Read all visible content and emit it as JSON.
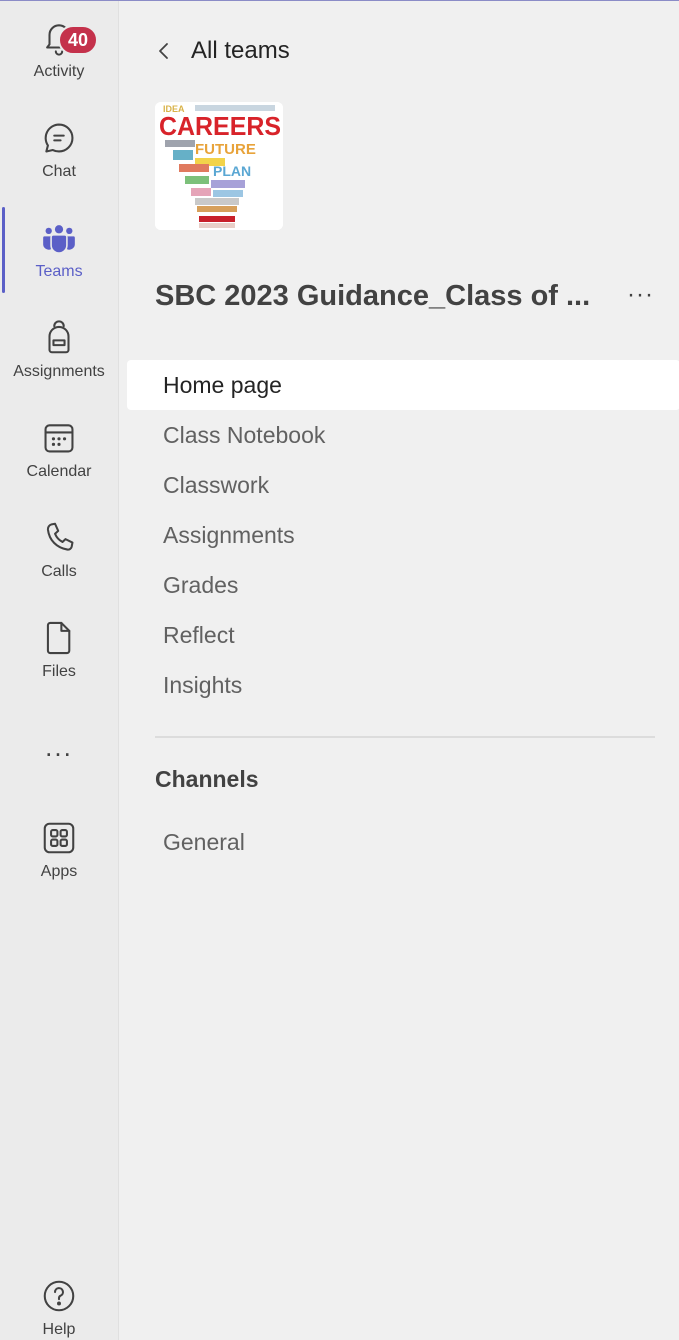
{
  "rail": {
    "items": [
      {
        "label": "Activity",
        "icon": "bell-icon",
        "badge": "40"
      },
      {
        "label": "Chat",
        "icon": "chat-icon"
      },
      {
        "label": "Teams",
        "icon": "teams-icon",
        "active": true
      },
      {
        "label": "Assignments",
        "icon": "backpack-icon"
      },
      {
        "label": "Calendar",
        "icon": "calendar-icon"
      },
      {
        "label": "Calls",
        "icon": "phone-icon"
      },
      {
        "label": "Files",
        "icon": "file-icon"
      },
      {
        "label": "Apps",
        "icon": "apps-icon"
      },
      {
        "label": "Help",
        "icon": "help-icon"
      }
    ],
    "more": "..."
  },
  "main": {
    "back_label": "All teams",
    "team": {
      "logo_text": "CAREERS",
      "logo_words": [
        "IDEA",
        "FUTURE",
        "PLAN"
      ],
      "name": "SBC 2023 Guidance_Class of ...",
      "more": "···"
    },
    "nav": [
      {
        "label": "Home page",
        "selected": true
      },
      {
        "label": "Class Notebook"
      },
      {
        "label": "Classwork"
      },
      {
        "label": "Assignments"
      },
      {
        "label": "Grades"
      },
      {
        "label": "Reflect"
      },
      {
        "label": "Insights"
      }
    ],
    "channels_heading": "Channels",
    "channels": [
      {
        "label": "General"
      }
    ]
  },
  "colors": {
    "accent": "#5b5fc7",
    "badge": "#c4314b",
    "rail_bg": "#ebebeb",
    "panel_bg": "#f0f0f0",
    "selected_bg": "#ffffff"
  }
}
